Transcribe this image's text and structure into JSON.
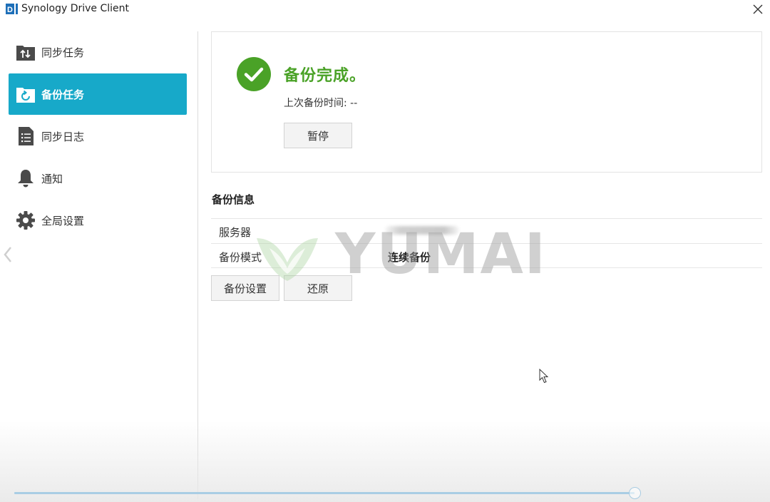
{
  "window": {
    "title": "Synology Drive Client",
    "logo_text": "D"
  },
  "sidebar": {
    "items": [
      {
        "label": "同步任务",
        "icon": "sync-task-icon",
        "active": false
      },
      {
        "label": "备份任务",
        "icon": "backup-task-icon",
        "active": true
      },
      {
        "label": "同步日志",
        "icon": "sync-log-icon",
        "active": false
      },
      {
        "label": "通知",
        "icon": "bell-icon",
        "active": false
      },
      {
        "label": "全局设置",
        "icon": "gear-icon",
        "active": false
      }
    ]
  },
  "status": {
    "title": "备份完成。",
    "last_backup": "上次备份时间: --",
    "pause_label": "暂停"
  },
  "info": {
    "heading": "备份信息",
    "rows": [
      {
        "key": "服务器",
        "value": ""
      },
      {
        "key": "备份模式",
        "value": "连续备份"
      }
    ],
    "backup_settings_label": "备份设置",
    "restore_label": "还原"
  },
  "watermark": {
    "text": "YUMAI"
  },
  "progress": {
    "value": 1.0
  },
  "colors": {
    "accent": "#17a9c9",
    "success": "#4aa227",
    "icon_gray": "#4a4a4a"
  }
}
